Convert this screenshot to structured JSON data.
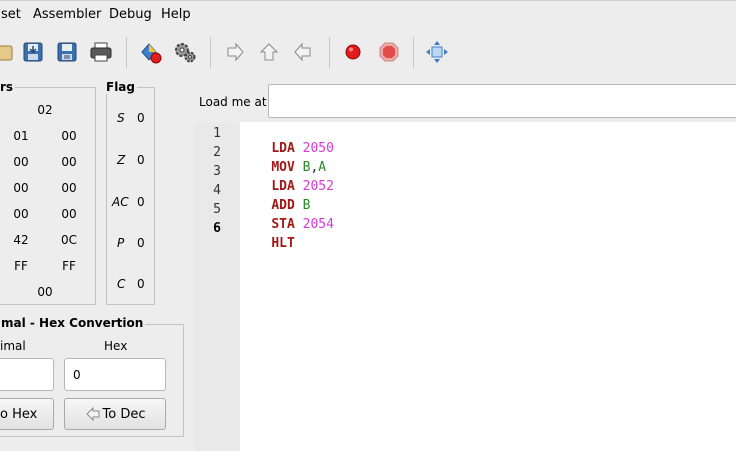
{
  "menubar": {
    "items": [
      "set",
      "Assembler",
      "Debug",
      "Help"
    ]
  },
  "toolbar": {
    "icons": [
      "open-icon",
      "save-icon",
      "save-as-icon",
      "print-icon",
      "assemble-icon",
      "settings-icon",
      "step-into-icon",
      "step-out-icon",
      "step-back-icon",
      "breakpoint-icon",
      "stop-icon",
      "center-icon"
    ]
  },
  "registers": {
    "title": "rs",
    "top": "02",
    "rows": [
      [
        "01",
        "00"
      ],
      [
        "00",
        "00"
      ],
      [
        "00",
        "00"
      ],
      [
        "00",
        "00"
      ],
      [
        "42",
        "0C"
      ],
      [
        "FF",
        "FF"
      ]
    ],
    "bottom": "00"
  },
  "flags": {
    "title": "Flag",
    "items": [
      {
        "name": "S",
        "value": "0"
      },
      {
        "name": "Z",
        "value": "0"
      },
      {
        "name": "AC",
        "value": "0"
      },
      {
        "name": "P",
        "value": "0"
      },
      {
        "name": "C",
        "value": "0"
      }
    ]
  },
  "converter": {
    "title": "mal - Hex Convertion",
    "decimal_label": "imal",
    "hex_label": "Hex",
    "decimal_value": "",
    "hex_value": "0",
    "to_hex_label": "o Hex",
    "to_dec_label": "To Dec"
  },
  "load": {
    "label": "Load me at",
    "value": ""
  },
  "editor": {
    "lines": [
      {
        "n": "1",
        "op": "LDA",
        "args": [
          {
            "t": "2050",
            "k": "num"
          }
        ]
      },
      {
        "n": "2",
        "op": "MOV",
        "args": [
          {
            "t": "B",
            "k": "reg-op"
          },
          {
            "t": ",",
            "k": "punct"
          },
          {
            "t": "A",
            "k": "reg-op"
          }
        ]
      },
      {
        "n": "3",
        "op": "LDA",
        "args": [
          {
            "t": "2052",
            "k": "num"
          }
        ]
      },
      {
        "n": "4",
        "op": "ADD",
        "args": [
          {
            "t": "B",
            "k": "reg-op"
          }
        ]
      },
      {
        "n": "5",
        "op": "STA",
        "args": [
          {
            "t": "2054",
            "k": "num"
          }
        ]
      },
      {
        "n": "6",
        "op": "HLT",
        "args": []
      }
    ]
  }
}
